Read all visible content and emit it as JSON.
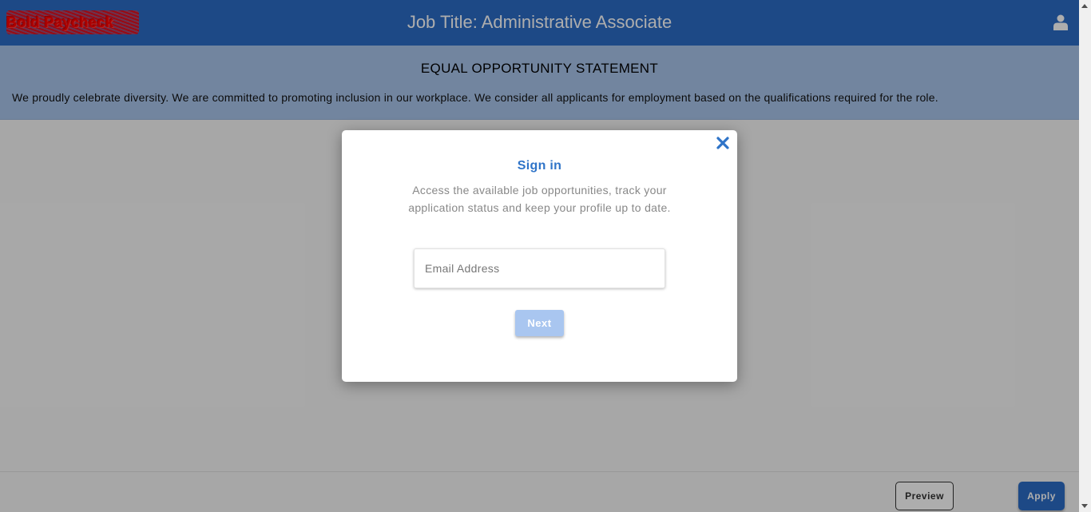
{
  "header": {
    "logo_text": "Bold Paycheck",
    "job_title": "Job Title: Administrative Associate",
    "user_icon": "user-icon",
    "background_color": "#2c6cc6"
  },
  "eo_statement": {
    "heading": "EQUAL OPPORTUNITY STATEMENT",
    "text": "We proudly celebrate diversity. We are committed to promoting inclusion in our workplace. We consider all applicants for employment based on the qualifications required for the role.",
    "background_color": "#a8c4eb"
  },
  "modal": {
    "close_icon": "close-icon",
    "title": "Sign in",
    "description": "Access the available job opportunities, track your application status and keep your profile up to date.",
    "email_placeholder": "Email Address",
    "email_value": "",
    "next_label": "Next",
    "accent_color": "#2f74c8"
  },
  "footer": {
    "preview_label": "Preview",
    "apply_label": "Apply"
  }
}
